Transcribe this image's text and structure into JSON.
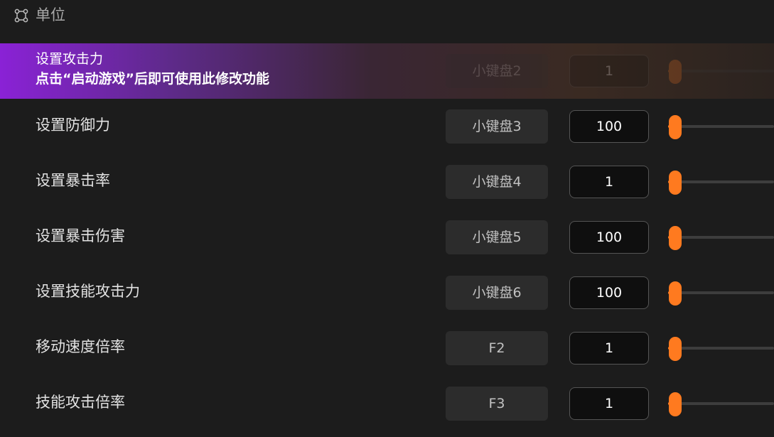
{
  "section": {
    "title": "单位",
    "icon": "vector-nodes-icon"
  },
  "hint": "点击“启动游戏”后即可使用此修改功能",
  "rows": [
    {
      "label": "设置攻击力",
      "hotkey": "小键盘2",
      "value": "1",
      "slider_level": 0,
      "highlighted": true
    },
    {
      "label": "设置防御力",
      "hotkey": "小键盘3",
      "value": "100",
      "slider_level": 0,
      "highlighted": false
    },
    {
      "label": "设置暴击率",
      "hotkey": "小键盘4",
      "value": "1",
      "slider_level": 0,
      "highlighted": false
    },
    {
      "label": "设置暴击伤害",
      "hotkey": "小键盘5",
      "value": "100",
      "slider_level": 0,
      "highlighted": false
    },
    {
      "label": "设置技能攻击力",
      "hotkey": "小键盘6",
      "value": "100",
      "slider_level": 0,
      "highlighted": false
    },
    {
      "label": "移动速度倍率",
      "hotkey": "F2",
      "value": "1",
      "slider_level": 0,
      "highlighted": false
    },
    {
      "label": "技能攻击倍率",
      "hotkey": "F3",
      "value": "1",
      "slider_level": 0,
      "highlighted": false
    }
  ],
  "colors": {
    "background": "#1c1c1c",
    "accent": "#ff7a1f",
    "highlight_start": "#8a22d6"
  }
}
